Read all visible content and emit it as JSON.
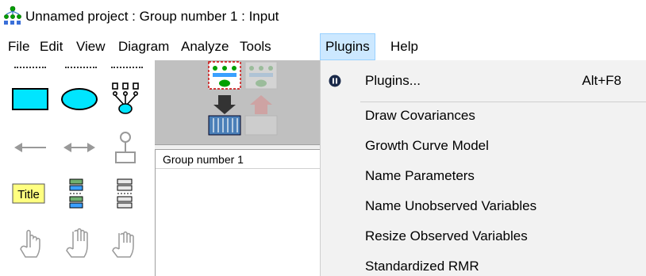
{
  "window": {
    "title": "Unnamed project : Group number 1 : Input",
    "icon": "amos-app-icon"
  },
  "menubar": {
    "items": [
      {
        "label": "File"
      },
      {
        "label": "Edit"
      },
      {
        "label": "View"
      },
      {
        "label": "Diagram"
      },
      {
        "label": "Analyze"
      },
      {
        "label": "Tools"
      },
      {
        "label": "Plugins",
        "active": true
      },
      {
        "label": "Help"
      }
    ]
  },
  "toolbox": {
    "tools": [
      {
        "name": "draw-observed-variable-icon"
      },
      {
        "name": "draw-unobserved-variable-icon"
      },
      {
        "name": "draw-latent-variable-indicators-icon"
      },
      {
        "name": "draw-path-icon"
      },
      {
        "name": "draw-covariance-icon"
      },
      {
        "name": "add-unique-variable-icon"
      },
      {
        "name": "figure-caption-icon",
        "label": "Title"
      },
      {
        "name": "list-variables-in-model-icon"
      },
      {
        "name": "list-variables-in-dataset-icon"
      },
      {
        "name": "select-one-object-icon"
      },
      {
        "name": "select-all-objects-icon"
      },
      {
        "name": "deselect-all-objects-icon"
      }
    ]
  },
  "view_buttons": [
    {
      "name": "view-input-path-diagram-icon",
      "state": "active"
    },
    {
      "name": "view-output-path-diagram-icon",
      "state": "disabled"
    }
  ],
  "groups_panel": {
    "header": "Group number 1"
  },
  "plugins_menu": {
    "items": [
      {
        "label": "Plugins...",
        "shortcut": "Alt+F8",
        "icon": "plugins-icon"
      },
      {
        "label": "Draw Covariances"
      },
      {
        "label": "Growth Curve Model"
      },
      {
        "label": "Name Parameters"
      },
      {
        "label": "Name Unobserved Variables"
      },
      {
        "label": "Resize Observed Variables"
      },
      {
        "label": "Standardized RMR"
      }
    ]
  },
  "colors": {
    "shape_fill": "#00e5ff",
    "title_fill": "#ffff80",
    "menu_active_bg": "#cce8ff",
    "menu_active_border": "#99d1ff",
    "dropdown_bg": "#f2f2f2"
  }
}
